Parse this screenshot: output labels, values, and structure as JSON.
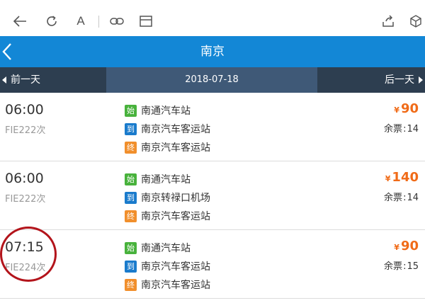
{
  "toolbar": {
    "icons": [
      "back-arrow-icon",
      "refresh-icon",
      "font-icon",
      "link-icon",
      "layout-icon",
      "share-icon",
      "cube-icon"
    ],
    "font_glyph": "A"
  },
  "header": {
    "title": "南京"
  },
  "datebar": {
    "prev": "前一天",
    "date": "2018-07-18",
    "next": "后一天"
  },
  "trips": [
    {
      "time": "06:00",
      "code": "FIE222次",
      "stops": [
        {
          "tag": "始",
          "name": "南通汽车站"
        },
        {
          "tag": "到",
          "name": "南京汽车客运站"
        },
        {
          "tag": "终",
          "name": "南京汽车客运站"
        }
      ],
      "yen": "¥",
      "price": "90",
      "seats_label": "余票",
      "seats": "14"
    },
    {
      "time": "06:00",
      "code": "FIE222次",
      "stops": [
        {
          "tag": "始",
          "name": "南通汽车站"
        },
        {
          "tag": "到",
          "name": "南京转禄口机场"
        },
        {
          "tag": "终",
          "name": "南京汽车客运站"
        }
      ],
      "yen": "¥",
      "price": "140",
      "seats_label": "余票",
      "seats": "14"
    },
    {
      "time": "07:15",
      "code": "FIE224次",
      "stops": [
        {
          "tag": "始",
          "name": "南通汽车站"
        },
        {
          "tag": "到",
          "name": "南京汽车客运站"
        },
        {
          "tag": "终",
          "name": "南京汽车客运站"
        }
      ],
      "yen": "¥",
      "price": "90",
      "seats_label": "余票",
      "seats": "15"
    }
  ],
  "colors": {
    "header_blue": "#1387d6",
    "datebar_dark": "#2d3e50",
    "datebar_active": "#3f5977",
    "price_orange": "#f06b18",
    "tag_start": "#48b23c",
    "tag_mid": "#1a7bcc",
    "tag_end": "#f18f2c",
    "annotation_red": "#b3141b"
  }
}
